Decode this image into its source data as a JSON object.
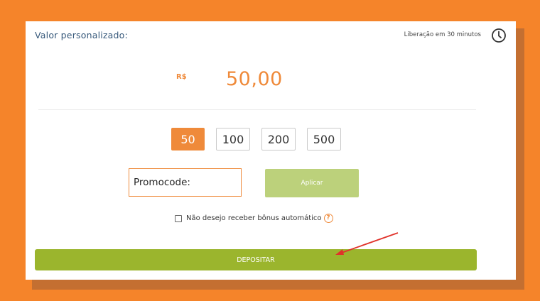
{
  "header": {
    "title": "Valor personalizado:",
    "release_text": "Liberação em 30 minutos",
    "release_icon": "clock-icon"
  },
  "amount": {
    "currency": "R$",
    "value": "50,00"
  },
  "quick_values": [
    {
      "label": "50",
      "selected": true
    },
    {
      "label": "100",
      "selected": false
    },
    {
      "label": "200",
      "selected": false
    },
    {
      "label": "500",
      "selected": false
    }
  ],
  "promo": {
    "placeholder": "Promocode:",
    "value": "",
    "apply_label": "Aplicar"
  },
  "bonus_opt_out": {
    "label": "Não desejo receber bônus automático",
    "checked": false,
    "help_icon": "question-circle-icon"
  },
  "deposit_label": "DEPOSITAR",
  "annotation": {
    "arrow_icon": "red-arrow-icon",
    "color": "#e0322a"
  },
  "colors": {
    "background": "#f5842a",
    "accent": "#ef8a3a",
    "deposit": "#9bb52d",
    "apply": "#bcd17b",
    "title": "#36587a"
  }
}
